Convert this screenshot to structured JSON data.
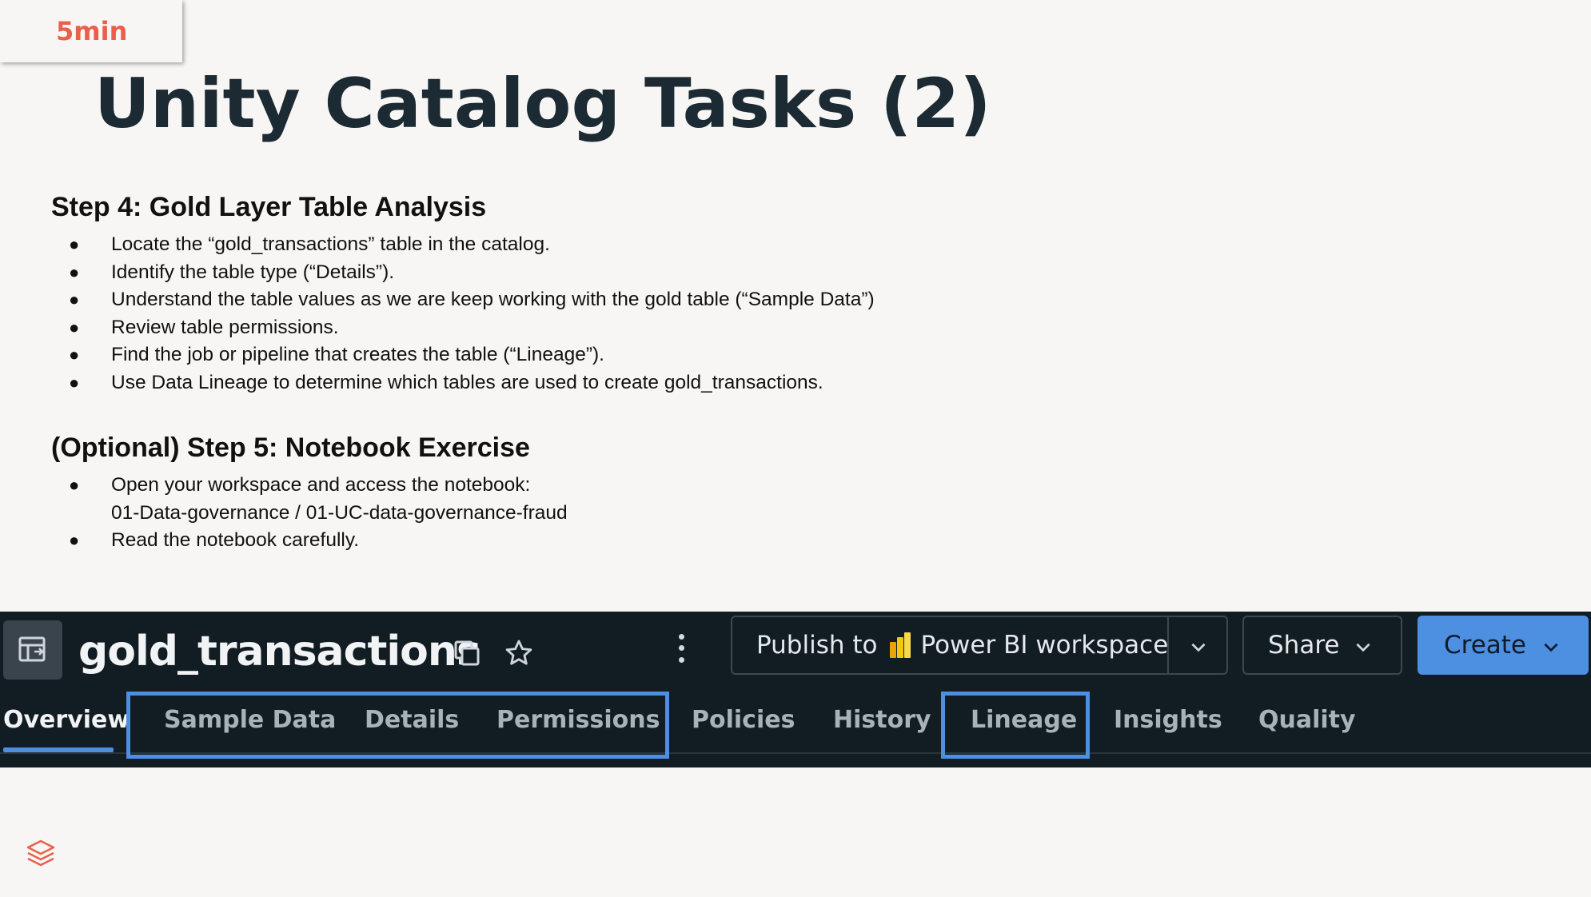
{
  "badge": {
    "time": "5min"
  },
  "title": "Unity Catalog Tasks (2)",
  "step4": {
    "heading": "Step 4: Gold Layer Table Analysis",
    "items": [
      "Locate the “gold_transactions” table in the catalog.",
      "Identify the table type (“Details”).",
      "Understand the table values as we are keep working with the gold table (“Sample Data”)",
      "Review table permissions.",
      "Find the job or pipeline that creates the table (“Lineage”).",
      "Use Data Lineage to determine which tables are used to create gold_transactions."
    ]
  },
  "step5": {
    "heading": "(Optional) Step 5: Notebook Exercise",
    "item1_line1": "Open your workspace and access the notebook:",
    "item1_line2": "01-Data-governance / 01-UC-data-governance-fraud",
    "item2": "Read the notebook carefully."
  },
  "ui": {
    "table_name": "gold_transactions",
    "publish_prefix": "Publish to",
    "publish_target": "Power BI workspace",
    "share_label": "Share",
    "create_label": "Create",
    "tabs": [
      "Overview",
      "Sample Data",
      "Details",
      "Permissions",
      "Policies",
      "History",
      "Lineage",
      "Insights",
      "Quality"
    ],
    "active_tab": "Overview",
    "accent_color": "#4d8fe0",
    "highlighted_tabs": [
      "Sample Data",
      "Details",
      "Permissions",
      "Lineage"
    ]
  },
  "colors": {
    "badge_text": "#e8604c",
    "title_text": "#1b2a33",
    "ui_background": "#121c23",
    "logo": "#e8604c"
  },
  "icons": {
    "table": "table-icon",
    "copy": "copy-icon",
    "star": "star-icon",
    "more": "kebab-menu-icon",
    "powerbi": "power-bi-icon",
    "caret": "chevron-down-icon",
    "brand": "databricks-logo-icon"
  }
}
